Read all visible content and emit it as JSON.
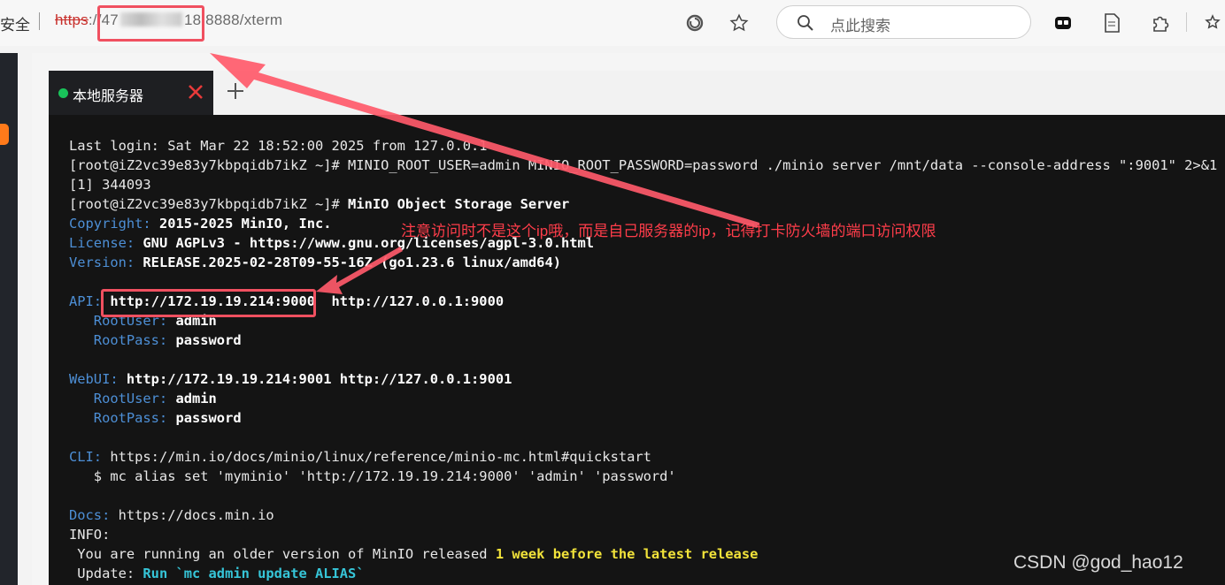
{
  "browser": {
    "security_label": "安全",
    "url_protocol": "https",
    "url_prefix": "://47",
    "url_suffix": "18:8888/xterm",
    "search_placeholder": "点此搜索"
  },
  "tabs": [
    {
      "label": "本地服务器",
      "status": "connected",
      "status_color": "#19c45a"
    }
  ],
  "terminal": {
    "lines": [
      [
        {
          "t": "Last login: Sat Mar 22 18:52:00 2025 from 127.0.0.1"
        }
      ],
      [
        {
          "t": "[root@iZ2vc39e83y7kbpqidb7ikZ ~]# MINIO_ROOT_USER=admin MINIO_ROOT_PASSWORD=password ./minio server /mnt/data --console-address \":9001\" 2>&1 &"
        }
      ],
      [
        {
          "t": "[1] 344093"
        }
      ],
      [
        {
          "t": "[root@iZ2vc39e83y7kbpqidb7ikZ ~]# "
        },
        {
          "t": "MinIO Object Storage Server",
          "s": "b"
        }
      ],
      [
        {
          "t": "Copyright: ",
          "s": "k"
        },
        {
          "t": "2015-2025 MinIO, Inc.",
          "s": "b"
        }
      ],
      [
        {
          "t": "License: ",
          "s": "k"
        },
        {
          "t": "GNU AGPLv3 - https://www.gnu.org/licenses/agpl-3.0.html",
          "s": "b"
        }
      ],
      [
        {
          "t": "Version: ",
          "s": "k"
        },
        {
          "t": "RELEASE.2025-02-28T09-55-16Z (go1.23.6 linux/amd64)",
          "s": "b"
        }
      ],
      [
        {
          "t": ""
        }
      ],
      [
        {
          "t": "API: ",
          "s": "k"
        },
        {
          "t": "http://172.19.19.214:9000  http://127.0.0.1:9000",
          "s": "b"
        }
      ],
      [
        {
          "t": "   RootUser: ",
          "s": "k"
        },
        {
          "t": "admin",
          "s": "b"
        }
      ],
      [
        {
          "t": "   RootPass: ",
          "s": "k"
        },
        {
          "t": "password",
          "s": "b"
        }
      ],
      [
        {
          "t": ""
        }
      ],
      [
        {
          "t": "WebUI: ",
          "s": "k"
        },
        {
          "t": "http://172.19.19.214:9001 http://127.0.0.1:9001",
          "s": "b"
        }
      ],
      [
        {
          "t": "   RootUser: ",
          "s": "k"
        },
        {
          "t": "admin",
          "s": "b"
        }
      ],
      [
        {
          "t": "   RootPass: ",
          "s": "k"
        },
        {
          "t": "password",
          "s": "b"
        }
      ],
      [
        {
          "t": ""
        }
      ],
      [
        {
          "t": "CLI: ",
          "s": "k"
        },
        {
          "t": "https://min.io/docs/minio/linux/reference/minio-mc.html#quickstart"
        }
      ],
      [
        {
          "t": "   $ mc alias set 'myminio' 'http://172.19.19.214:9000' 'admin' 'password'"
        }
      ],
      [
        {
          "t": ""
        }
      ],
      [
        {
          "t": "Docs: ",
          "s": "k"
        },
        {
          "t": "https://docs.min.io"
        }
      ],
      [
        {
          "t": "INFO:"
        }
      ],
      [
        {
          "t": " You are running an older version of MinIO released "
        },
        {
          "t": "1 week before the latest release",
          "s": "y"
        }
      ],
      [
        {
          "t": " Update: "
        },
        {
          "t": "Run `mc admin update ALIAS`",
          "s": "c"
        }
      ]
    ]
  },
  "annotation": {
    "note": "注意访问时不是这个ip哦，而是自己服务器的ip，记得打卡防火墙的端口访问权限",
    "color": "#ff3d4a"
  },
  "watermark": "CSDN @god_hao12"
}
